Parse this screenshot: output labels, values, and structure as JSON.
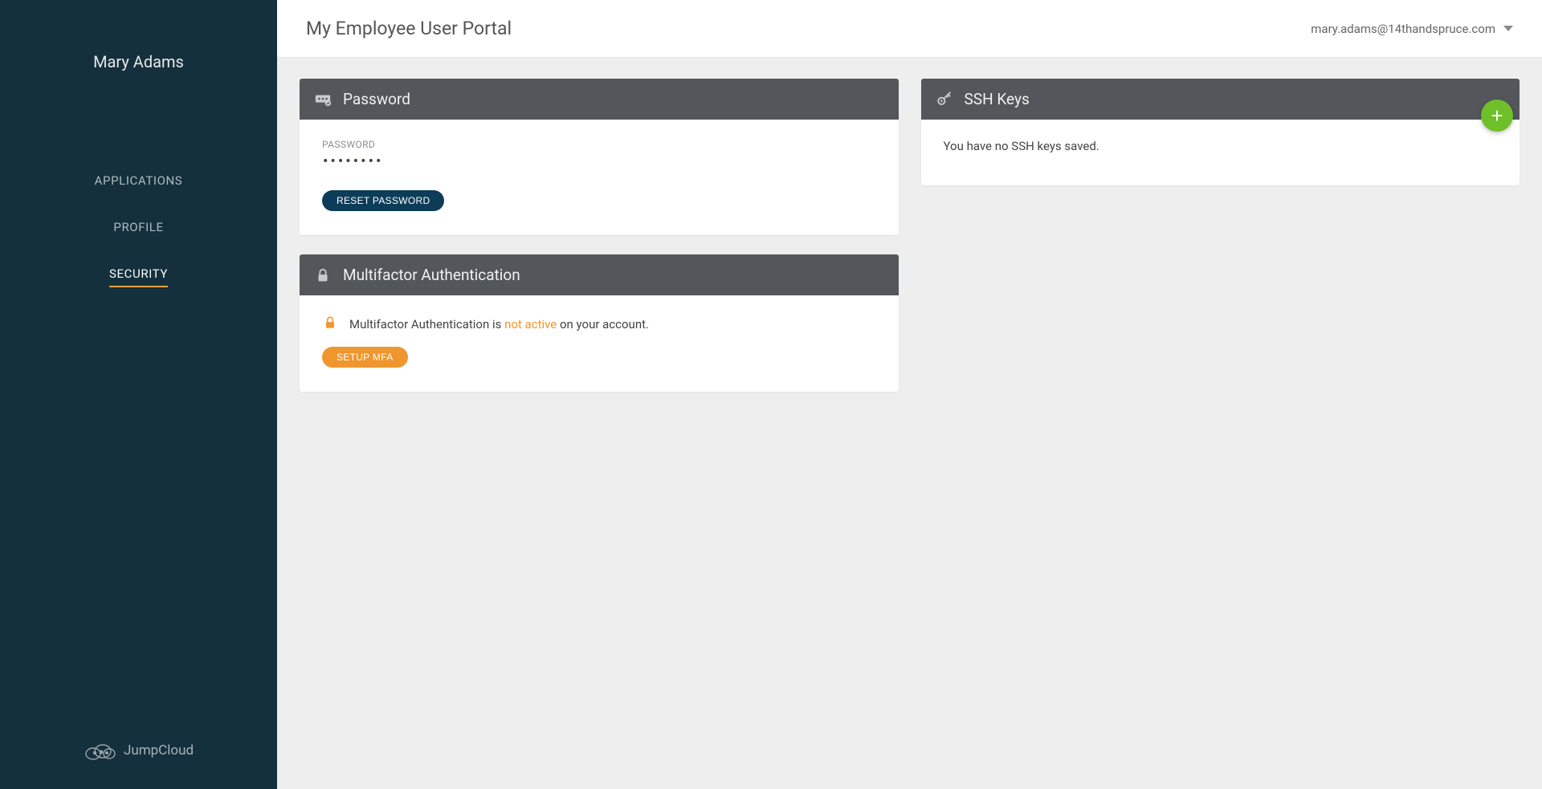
{
  "sidebar": {
    "username": "Mary Adams",
    "nav": [
      {
        "label": "APPLICATIONS"
      },
      {
        "label": "PROFILE"
      },
      {
        "label": "SECURITY"
      }
    ],
    "brand": "JumpCloud"
  },
  "header": {
    "title": "My Employee User Portal",
    "user_email": "mary.adams@14thandspruce.com"
  },
  "password_panel": {
    "title": "Password",
    "field_label": "PASSWORD",
    "field_value": "••••••••",
    "reset_button": "RESET PASSWORD"
  },
  "mfa_panel": {
    "title": "Multifactor Authentication",
    "status_prefix": "Multifactor Authentication is ",
    "status_value": "not active",
    "status_suffix": " on your account.",
    "setup_button": "SETUP MFA"
  },
  "ssh_panel": {
    "title": "SSH Keys",
    "empty_text": "You have no SSH keys saved."
  }
}
